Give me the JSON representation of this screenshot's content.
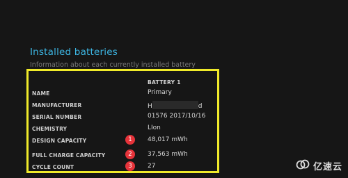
{
  "section": {
    "title": "Installed batteries",
    "subtitle": "Information about each currently installed battery"
  },
  "table": {
    "column_header": "BATTERY 1",
    "rows": [
      {
        "label": "NAME",
        "value": "Primary"
      },
      {
        "label": "MANUFACTURER",
        "value_prefix": "H",
        "value_suffix": "d"
      },
      {
        "label": "SERIAL NUMBER",
        "value": "01576 2017/10/16"
      },
      {
        "label": "CHEMISTRY",
        "value": "LIon"
      },
      {
        "label": "DESIGN CAPACITY",
        "value": "48,017 mWh",
        "badge": "1"
      },
      {
        "label": "FULL CHARGE CAPACITY",
        "value": "37,563 mWh",
        "badge": "2"
      },
      {
        "label": "CYCLE COUNT",
        "value": "27",
        "badge": "3"
      }
    ]
  },
  "annotations": {
    "highlight_color": "#f0ea2a",
    "badge_color": "#e6333a"
  },
  "watermark": {
    "text": "亿速云",
    "icon": "cloud-logo-icon"
  }
}
